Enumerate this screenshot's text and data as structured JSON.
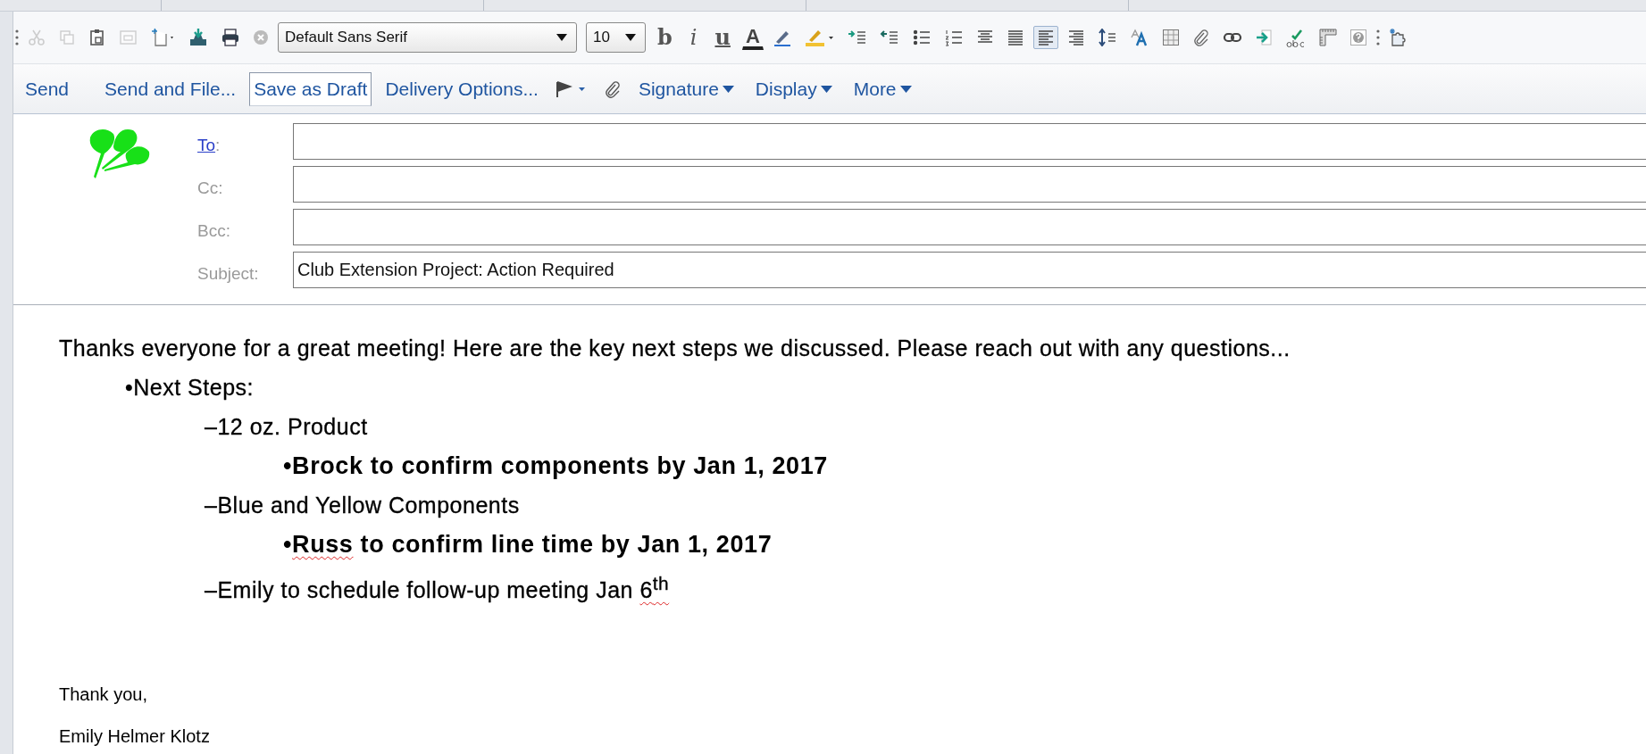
{
  "toolbar": {
    "edit_buttons": [
      {
        "disabled": true
      },
      {
        "disabled": true
      },
      {
        "disabled": false
      },
      {
        "disabled": true
      }
    ],
    "font": "Default Sans Serif",
    "size": "10",
    "bold_label": "b",
    "italic_label": "i",
    "underline_label": "u",
    "font_color_label": "A",
    "align_buttons": [
      {
        "selected": false
      },
      {
        "selected": false
      },
      {
        "selected": true
      },
      {
        "selected": false
      }
    ]
  },
  "actions": [
    {
      "label": "Send",
      "highlighted": false
    },
    {
      "label": "Send and File...",
      "highlighted": false
    },
    {
      "label": "Save as Draft",
      "highlighted": true
    },
    {
      "label": "Delivery Options...",
      "highlighted": false
    }
  ],
  "menus": [
    {
      "label": "Signature"
    },
    {
      "label": "Display"
    },
    {
      "label": "More"
    }
  ],
  "header": {
    "fields": [
      {
        "label": "To",
        "separator": ":",
        "kind": "link"
      },
      {
        "label": "Cc",
        "separator": ":",
        "kind": "plain"
      },
      {
        "label": "Bcc",
        "separator": ":",
        "kind": "plain"
      },
      {
        "label": "Subject",
        "separator": ":",
        "kind": "plain",
        "value": "Club Extension Project: Action Required"
      }
    ]
  },
  "body": {
    "intro": "Thanks everyone for a great meeting! Here are the key next steps we discussed. Please reach out with any questions...",
    "list": [
      {
        "marker": "•",
        "bold": false,
        "segments": [
          {
            "text": "Next Steps:",
            "misspelled": false
          }
        ],
        "children": [
          {
            "marker": "–",
            "bold": false,
            "segments": [
              {
                "text": "12 oz. Product",
                "misspelled": false
              }
            ],
            "children": [
              {
                "marker": "•",
                "bold": true,
                "segments": [
                  {
                    "text": "Brock to confirm components by Jan 1, 2017",
                    "misspelled": false
                  }
                ]
              }
            ]
          },
          {
            "marker": "–",
            "bold": false,
            "segments": [
              {
                "text": "Blue and Yellow Components",
                "misspelled": false
              }
            ],
            "children": [
              {
                "marker": "•",
                "bold": true,
                "segments": [
                  {
                    "text": "Russ",
                    "misspelled": true
                  },
                  {
                    "text": " to confirm line time by Jan 1, 2017",
                    "misspelled": false
                  }
                ]
              }
            ]
          },
          {
            "marker": "–",
            "bold": false,
            "segments": [
              {
                "text": "Emily to schedule follow-up meeting Jan ",
                "misspelled": false
              },
              {
                "text": "6$^{th}$",
                "misspelled": true
              }
            ]
          }
        ]
      }
    ],
    "closing": "Thank you,",
    "signature": "Emily Helmer Klotz"
  }
}
